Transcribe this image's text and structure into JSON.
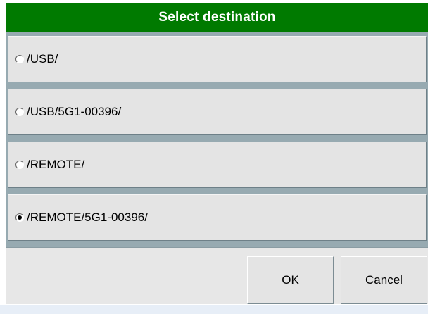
{
  "dialog": {
    "title": "Select destination",
    "options": [
      {
        "label": "/USB/",
        "selected": false
      },
      {
        "label": "/USB/5G1-00396/",
        "selected": false
      },
      {
        "label": "/REMOTE/",
        "selected": false
      },
      {
        "label": "/REMOTE/5G1-00396/",
        "selected": true
      }
    ],
    "ok_label": "OK",
    "cancel_label": "Cancel"
  },
  "colors": {
    "titlebar": "#007a00",
    "option_bg": "#e4e4e4",
    "frame": "#97aab1"
  }
}
